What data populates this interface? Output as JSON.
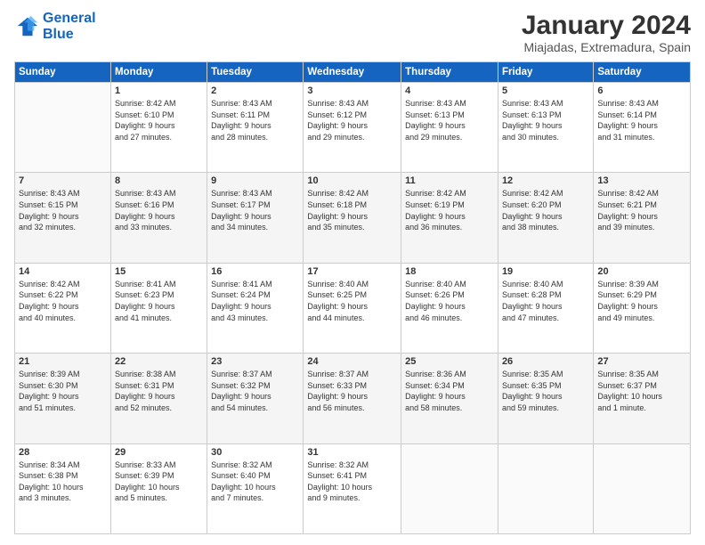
{
  "logo": {
    "line1": "General",
    "line2": "Blue"
  },
  "title": "January 2024",
  "subtitle": "Miajadas, Extremadura, Spain",
  "header": {
    "days": [
      "Sunday",
      "Monday",
      "Tuesday",
      "Wednesday",
      "Thursday",
      "Friday",
      "Saturday"
    ]
  },
  "weeks": [
    [
      {
        "day": "",
        "info": ""
      },
      {
        "day": "1",
        "info": "Sunrise: 8:42 AM\nSunset: 6:10 PM\nDaylight: 9 hours\nand 27 minutes."
      },
      {
        "day": "2",
        "info": "Sunrise: 8:43 AM\nSunset: 6:11 PM\nDaylight: 9 hours\nand 28 minutes."
      },
      {
        "day": "3",
        "info": "Sunrise: 8:43 AM\nSunset: 6:12 PM\nDaylight: 9 hours\nand 29 minutes."
      },
      {
        "day": "4",
        "info": "Sunrise: 8:43 AM\nSunset: 6:13 PM\nDaylight: 9 hours\nand 29 minutes."
      },
      {
        "day": "5",
        "info": "Sunrise: 8:43 AM\nSunset: 6:13 PM\nDaylight: 9 hours\nand 30 minutes."
      },
      {
        "day": "6",
        "info": "Sunrise: 8:43 AM\nSunset: 6:14 PM\nDaylight: 9 hours\nand 31 minutes."
      }
    ],
    [
      {
        "day": "7",
        "info": "Sunrise: 8:43 AM\nSunset: 6:15 PM\nDaylight: 9 hours\nand 32 minutes."
      },
      {
        "day": "8",
        "info": "Sunrise: 8:43 AM\nSunset: 6:16 PM\nDaylight: 9 hours\nand 33 minutes."
      },
      {
        "day": "9",
        "info": "Sunrise: 8:43 AM\nSunset: 6:17 PM\nDaylight: 9 hours\nand 34 minutes."
      },
      {
        "day": "10",
        "info": "Sunrise: 8:42 AM\nSunset: 6:18 PM\nDaylight: 9 hours\nand 35 minutes."
      },
      {
        "day": "11",
        "info": "Sunrise: 8:42 AM\nSunset: 6:19 PM\nDaylight: 9 hours\nand 36 minutes."
      },
      {
        "day": "12",
        "info": "Sunrise: 8:42 AM\nSunset: 6:20 PM\nDaylight: 9 hours\nand 38 minutes."
      },
      {
        "day": "13",
        "info": "Sunrise: 8:42 AM\nSunset: 6:21 PM\nDaylight: 9 hours\nand 39 minutes."
      }
    ],
    [
      {
        "day": "14",
        "info": "Sunrise: 8:42 AM\nSunset: 6:22 PM\nDaylight: 9 hours\nand 40 minutes."
      },
      {
        "day": "15",
        "info": "Sunrise: 8:41 AM\nSunset: 6:23 PM\nDaylight: 9 hours\nand 41 minutes."
      },
      {
        "day": "16",
        "info": "Sunrise: 8:41 AM\nSunset: 6:24 PM\nDaylight: 9 hours\nand 43 minutes."
      },
      {
        "day": "17",
        "info": "Sunrise: 8:40 AM\nSunset: 6:25 PM\nDaylight: 9 hours\nand 44 minutes."
      },
      {
        "day": "18",
        "info": "Sunrise: 8:40 AM\nSunset: 6:26 PM\nDaylight: 9 hours\nand 46 minutes."
      },
      {
        "day": "19",
        "info": "Sunrise: 8:40 AM\nSunset: 6:28 PM\nDaylight: 9 hours\nand 47 minutes."
      },
      {
        "day": "20",
        "info": "Sunrise: 8:39 AM\nSunset: 6:29 PM\nDaylight: 9 hours\nand 49 minutes."
      }
    ],
    [
      {
        "day": "21",
        "info": "Sunrise: 8:39 AM\nSunset: 6:30 PM\nDaylight: 9 hours\nand 51 minutes."
      },
      {
        "day": "22",
        "info": "Sunrise: 8:38 AM\nSunset: 6:31 PM\nDaylight: 9 hours\nand 52 minutes."
      },
      {
        "day": "23",
        "info": "Sunrise: 8:37 AM\nSunset: 6:32 PM\nDaylight: 9 hours\nand 54 minutes."
      },
      {
        "day": "24",
        "info": "Sunrise: 8:37 AM\nSunset: 6:33 PM\nDaylight: 9 hours\nand 56 minutes."
      },
      {
        "day": "25",
        "info": "Sunrise: 8:36 AM\nSunset: 6:34 PM\nDaylight: 9 hours\nand 58 minutes."
      },
      {
        "day": "26",
        "info": "Sunrise: 8:35 AM\nSunset: 6:35 PM\nDaylight: 9 hours\nand 59 minutes."
      },
      {
        "day": "27",
        "info": "Sunrise: 8:35 AM\nSunset: 6:37 PM\nDaylight: 10 hours\nand 1 minute."
      }
    ],
    [
      {
        "day": "28",
        "info": "Sunrise: 8:34 AM\nSunset: 6:38 PM\nDaylight: 10 hours\nand 3 minutes."
      },
      {
        "day": "29",
        "info": "Sunrise: 8:33 AM\nSunset: 6:39 PM\nDaylight: 10 hours\nand 5 minutes."
      },
      {
        "day": "30",
        "info": "Sunrise: 8:32 AM\nSunset: 6:40 PM\nDaylight: 10 hours\nand 7 minutes."
      },
      {
        "day": "31",
        "info": "Sunrise: 8:32 AM\nSunset: 6:41 PM\nDaylight: 10 hours\nand 9 minutes."
      },
      {
        "day": "",
        "info": ""
      },
      {
        "day": "",
        "info": ""
      },
      {
        "day": "",
        "info": ""
      }
    ]
  ]
}
